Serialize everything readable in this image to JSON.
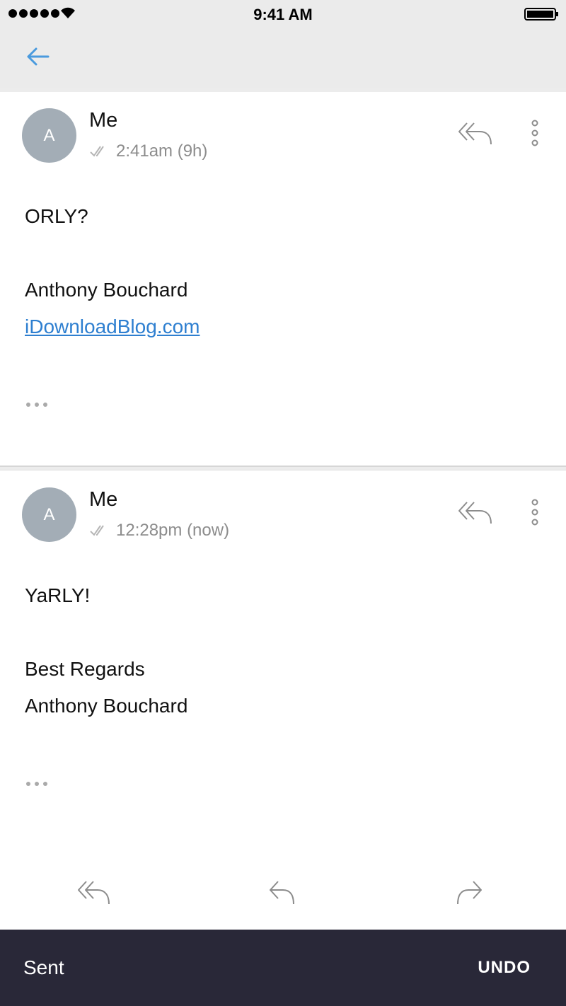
{
  "status_bar": {
    "time": "9:41 AM"
  },
  "colors": {
    "accent": "#2e7fd0",
    "avatar": "#a3adb6",
    "snackbar": "#292838"
  },
  "messages": [
    {
      "avatar_initial": "A",
      "sender": "Me",
      "time": "2:41am (9h)",
      "body": [
        "ORLY?",
        "Anthony Bouchard"
      ],
      "link": "iDownloadBlog.com"
    },
    {
      "avatar_initial": "A",
      "sender": "Me",
      "time": "12:28pm (now)",
      "body": [
        "YaRLY!",
        "Best Regards",
        "Anthony Bouchard"
      ]
    }
  ],
  "icons": {
    "back": "back-arrow-icon",
    "reply_all": "reply-all-icon",
    "reply": "reply-icon",
    "forward": "forward-icon",
    "more": "more-vertical-icon"
  },
  "snackbar": {
    "text": "Sent",
    "action": "UNDO"
  }
}
